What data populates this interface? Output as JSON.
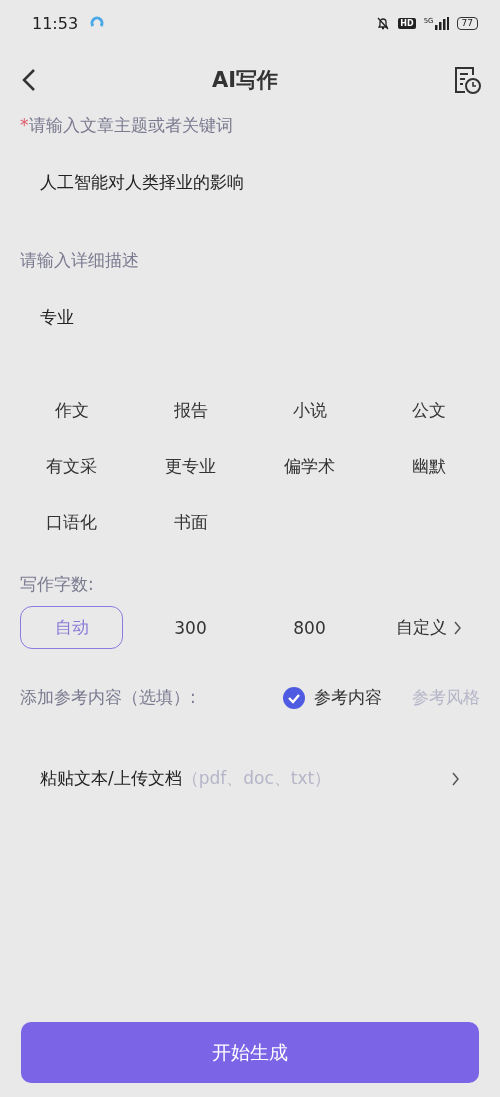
{
  "status_bar": {
    "time": "11:53",
    "hd": "HD",
    "network": "5G",
    "battery": "77"
  },
  "header": {
    "title": "AI写作"
  },
  "topic": {
    "required_mark": "*",
    "label": "请输入文章主题或者关键词",
    "value": "人工智能对人类择业的影响"
  },
  "description": {
    "label": "请输入详细描述",
    "value": "专业"
  },
  "styles": [
    {
      "label": "作文"
    },
    {
      "label": "报告"
    },
    {
      "label": "小说"
    },
    {
      "label": "公文"
    },
    {
      "label": "有文采"
    },
    {
      "label": "更专业"
    },
    {
      "label": "偏学术"
    },
    {
      "label": "幽默"
    },
    {
      "label": "口语化"
    },
    {
      "label": "书面"
    }
  ],
  "word_count": {
    "label": "写作字数:",
    "options": [
      {
        "label": "自动",
        "selected": true,
        "kind": "option"
      },
      {
        "label": "300",
        "selected": false,
        "kind": "option"
      },
      {
        "label": "800",
        "selected": false,
        "kind": "option"
      },
      {
        "label": "自定义",
        "selected": false,
        "kind": "custom"
      }
    ]
  },
  "reference": {
    "label": "添加参考内容（选填）:",
    "options": [
      {
        "label": "参考内容",
        "selected": true
      },
      {
        "label": "参考风格",
        "selected": false
      }
    ]
  },
  "upload": {
    "label": "粘贴文本/上传文档",
    "hint": "（pdf、doc、txt）"
  },
  "submit": {
    "label": "开始生成"
  }
}
